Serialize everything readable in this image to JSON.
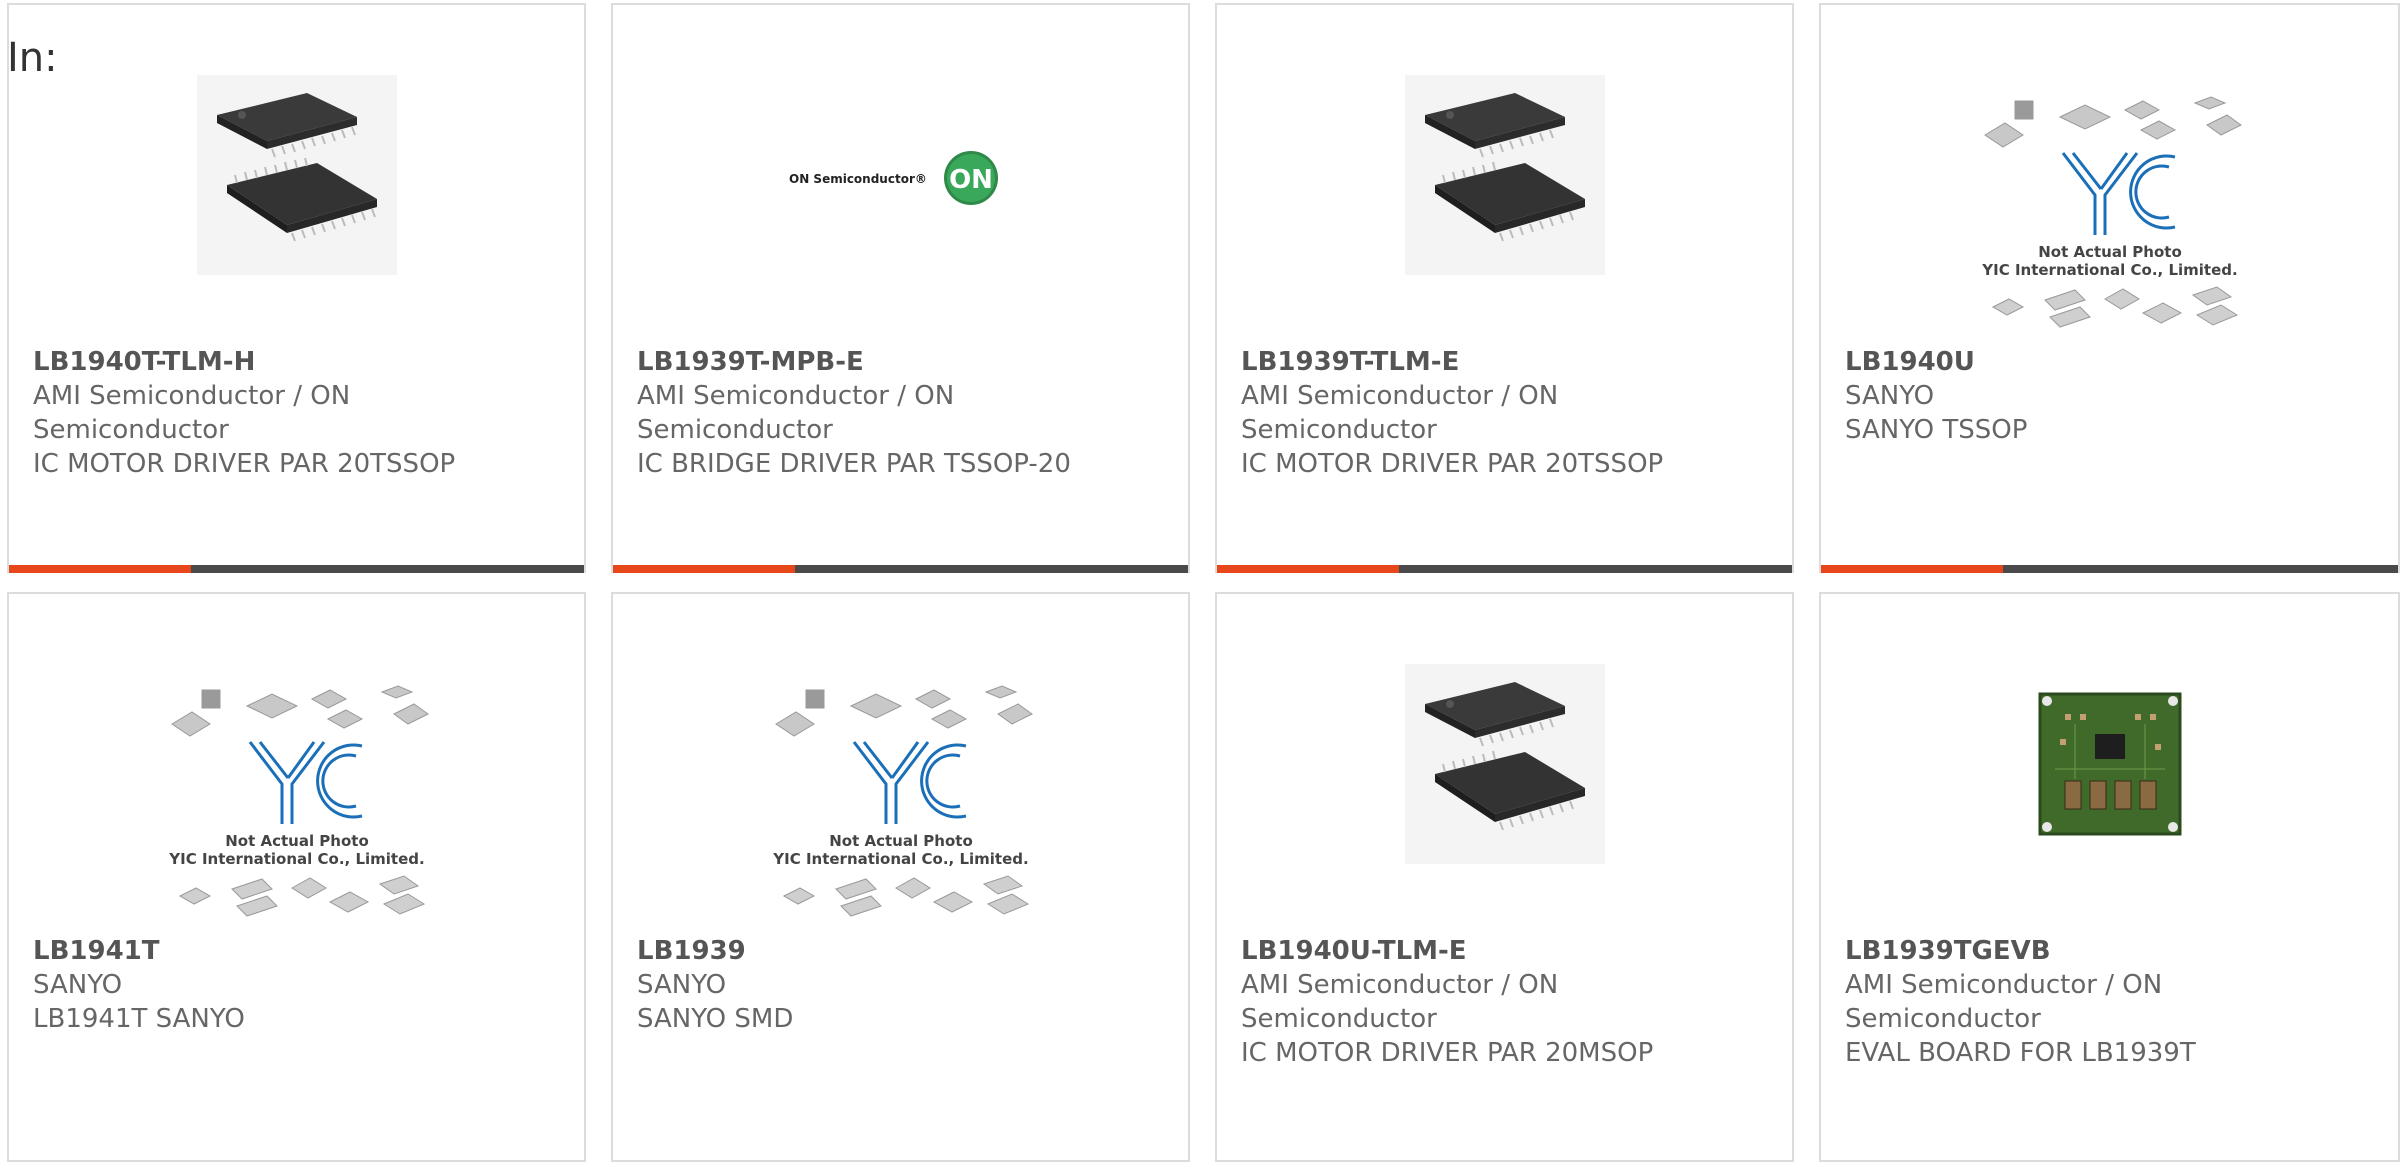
{
  "heading": "In:",
  "colors": {
    "accent": "#e8471b",
    "bar": "#4a4a4a",
    "border": "#dcdcdc"
  },
  "products": [
    {
      "part_number": "LB1940T-TLM-H",
      "manufacturer": "AMI Semiconductor / ON Semiconductor",
      "description": "IC MOTOR DRIVER PAR 20TSSOP",
      "image": "tssop-chip-photo"
    },
    {
      "part_number": "LB1939T-MPB-E",
      "manufacturer": "AMI Semiconductor / ON Semiconductor",
      "description": "IC BRIDGE DRIVER PAR TSSOP-20",
      "image": "on-semiconductor-logo",
      "logo_text": "ON Semiconductor®",
      "logo_badge": "ON"
    },
    {
      "part_number": "LB1939T-TLM-E",
      "manufacturer": "AMI Semiconductor / ON Semiconductor",
      "description": "IC MOTOR DRIVER PAR 20TSSOP",
      "image": "tssop-chip-photo"
    },
    {
      "part_number": "LB1940U",
      "manufacturer": "SANYO",
      "description": "SANYO TSSOP",
      "image": "yic-placeholder",
      "placeholder_line1": "Not Actual Photo",
      "placeholder_line2": "YIC International Co., Limited."
    },
    {
      "part_number": "LB1941T",
      "manufacturer": "SANYO",
      "description": "LB1941T SANYO",
      "image": "yic-placeholder",
      "placeholder_line1": "Not Actual Photo",
      "placeholder_line2": "YIC International Co., Limited."
    },
    {
      "part_number": "LB1939",
      "manufacturer": "SANYO",
      "description": "SANYO SMD",
      "image": "yic-placeholder",
      "placeholder_line1": "Not Actual Photo",
      "placeholder_line2": "YIC International Co., Limited."
    },
    {
      "part_number": "LB1940U-TLM-E",
      "manufacturer": "AMI Semiconductor / ON Semiconductor",
      "description": "IC MOTOR DRIVER PAR 20MSOP",
      "image": "tssop-chip-photo"
    },
    {
      "part_number": "LB1939TGEVB",
      "manufacturer": "AMI Semiconductor / ON Semiconductor",
      "description": "EVAL BOARD FOR LB1939T",
      "image": "eval-board-photo"
    }
  ]
}
